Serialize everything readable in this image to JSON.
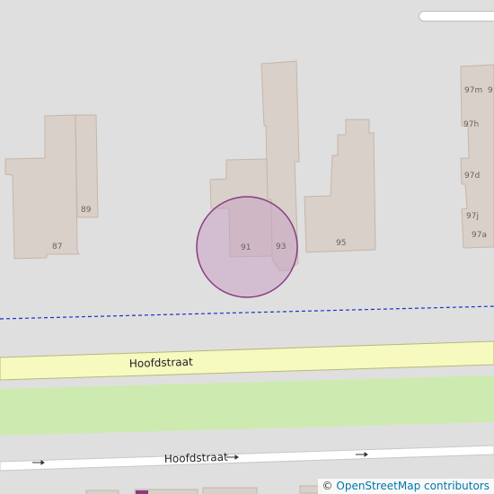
{
  "map": {
    "house_numbers": [
      "87",
      "89",
      "91",
      "93",
      "95",
      "97m",
      "97h",
      "97d",
      "97j",
      "97a",
      "9"
    ],
    "streets": {
      "upper": "Hoofdstraat",
      "lower": "Hoofdstraat"
    },
    "colors": {
      "background": "#e0dfdf",
      "building_fill": "#d9d0c9",
      "building_stroke": "#c4b6ab",
      "road_fill": "#f7fabf",
      "road_stroke": "#b9b77c",
      "grass": "#cdebb0",
      "highlight_fill": "#c6a3c2",
      "highlight_stroke": "#8a3c82",
      "boundary": "#1a32c8"
    }
  },
  "attribution": {
    "symbol": "©",
    "text": "OpenStreetMap contributors"
  }
}
